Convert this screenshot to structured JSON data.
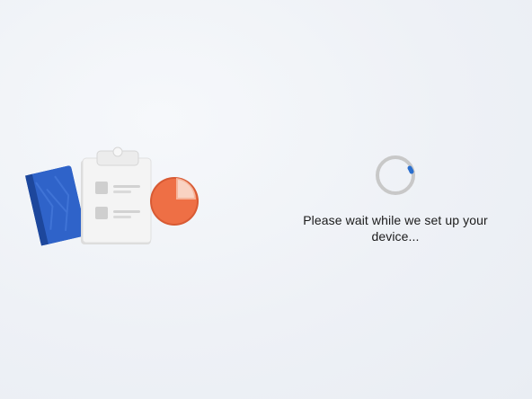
{
  "setup": {
    "message": "Please wait while we set up your device..."
  },
  "illustration": {
    "items": [
      "notebook-icon",
      "clipboard-icon",
      "pie-chart-icon"
    ]
  },
  "colors": {
    "background": "#eef1f6",
    "notebook": "#2f5fc4",
    "clipboard": "#f2f2f2",
    "pie": "#ee6f45",
    "spinner_track": "#c8c8c8",
    "spinner_accent": "#2a6fce",
    "text": "#1b1b1b"
  }
}
